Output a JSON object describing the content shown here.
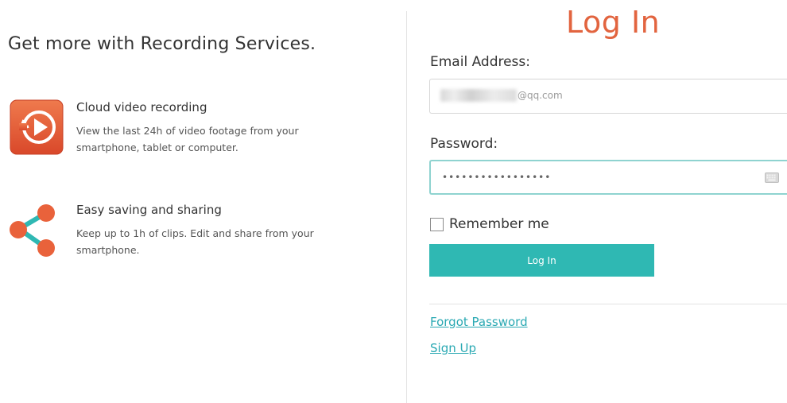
{
  "promo": {
    "title": "Get more with Recording Services.",
    "features": [
      {
        "icon": "cloud-video-recording-icon",
        "heading": "Cloud video recording",
        "description": "View the last 24h of video footage from your smartphone, tablet or computer."
      },
      {
        "icon": "share-icon",
        "heading": "Easy saving and sharing",
        "description": "Keep up to 1h of clips. Edit and share from your smartphone."
      }
    ]
  },
  "login": {
    "title": "Log In",
    "email_label": "Email Address:",
    "email_value_suffix": "@qq.com",
    "password_label": "Password:",
    "password_value": "•••••••••••••••••",
    "remember_label": "Remember me",
    "remember_checked": false,
    "button_label": "Log In",
    "forgot_link": "Forgot Password",
    "signup_link": "Sign Up"
  },
  "colors": {
    "accent_orange": "#e2643f",
    "teal": "#2fb8b3",
    "link": "#2aa9b3",
    "focus_border": "#8fd3d0"
  }
}
